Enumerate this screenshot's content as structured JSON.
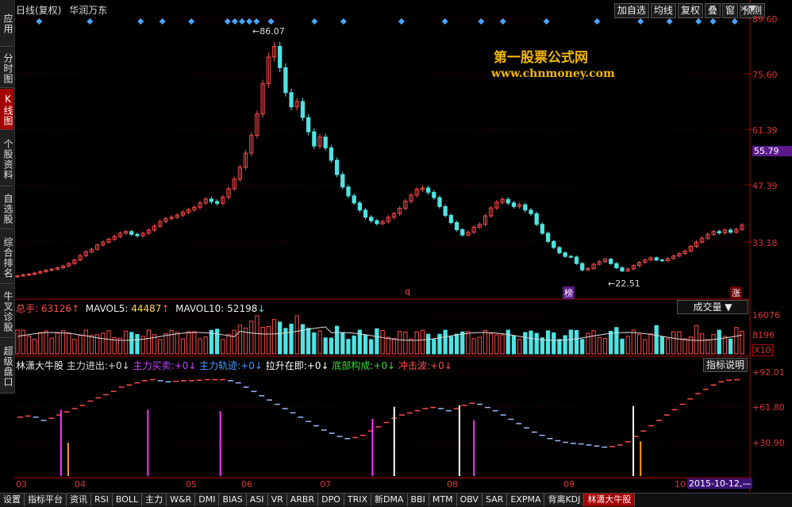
{
  "nav": [
    "应用",
    "分时图",
    "K线图",
    "个股资料",
    "自选股",
    "综合排名",
    "牛叉诊股",
    "超级盘口"
  ],
  "title": {
    "period": "日线(复权)",
    "stock": "华润万东"
  },
  "toolbar": [
    "加自选",
    "均线",
    "复权",
    "叠",
    "窗",
    "预测"
  ],
  "controls": {
    "close": "×",
    "menu": "▼"
  },
  "price_axis": [
    "89.60",
    "75.60",
    "61.39",
    "47.39",
    "33.18"
  ],
  "current_price": "55.79",
  "annotations": {
    "high": "86.07",
    "low": "22.51",
    "q": "q",
    "bang": "榜",
    "zhang": "涨"
  },
  "watermark": {
    "line1": "第一股票公式网",
    "line2": "www.chnmoney.com"
  },
  "volume": {
    "total_label": "总手:",
    "total": "63126",
    "ma5_label": "MAVOL5:",
    "ma5": "44487",
    "ma10_label": "MAVOL10:",
    "ma10": "52198",
    "selector": "成交量 ▼",
    "axis": [
      "16076",
      "8196"
    ],
    "unit": "X10"
  },
  "indicator": {
    "name": "林潇大牛股",
    "fields": [
      {
        "label": "主力进出:",
        "value": "+0",
        "color": "#dddddd"
      },
      {
        "label": "主力买卖:",
        "value": "+0",
        "color": "#cc44ff"
      },
      {
        "label": "主力轨迹:",
        "value": "+0",
        "color": "#4a9cff"
      },
      {
        "label": "拉升在即:",
        "value": "+0",
        "color": "#ffffff"
      },
      {
        "label": "底部构成:",
        "value": "+0",
        "color": "#33dd33"
      },
      {
        "label": "冲击波:",
        "value": "+0",
        "color": "#ff5050"
      }
    ],
    "button": "指标说明",
    "axis": [
      "+92.01",
      "+61.80",
      "+30.90"
    ]
  },
  "date_axis": [
    "03",
    "04",
    "05",
    "06",
    "07",
    "08",
    "09",
    "10"
  ],
  "date_box": "2015-10-12,—",
  "tabs": [
    "设置",
    "指标平台",
    "资讯",
    "RSI",
    "BOLL",
    "主力",
    "W&R",
    "DMI",
    "BIAS",
    "ASI",
    "VR",
    "ARBR",
    "DPO",
    "TRIX",
    "新DMA",
    "BBI",
    "MTM",
    "OBV",
    "SAR",
    "EXPMA",
    "背离KDJ",
    "林潇大牛股"
  ],
  "colors": {
    "up": "#ff4b4b",
    "down": "#4fe3e3",
    "axis": "#b00000",
    "magenta": "#ff33ff",
    "orange": "#ff9d1e"
  },
  "price_series": [
    21.5,
    21.8,
    22.0,
    22.3,
    22.7,
    23.1,
    23.4,
    23.8,
    24.3,
    25.0,
    26.0,
    27.2,
    28.3,
    29.0,
    30.2,
    31.0,
    31.8,
    32.6,
    33.5,
    34.0,
    33.2,
    32.8,
    33.5,
    34.4,
    35.5,
    36.8,
    37.6,
    38.0,
    38.6,
    39.4,
    40.1,
    40.8,
    42.0,
    43.1,
    42.4,
    41.9,
    43.6,
    46.0,
    48.7,
    52.0,
    56.0,
    61.0,
    67.0,
    75.5,
    83.0,
    86.0,
    80.0,
    73.0,
    69.0,
    70.5,
    66.0,
    62.0,
    58.0,
    60.5,
    57.5,
    54.0,
    50.0,
    46.5,
    44.0,
    42.0,
    40.0,
    38.0,
    37.0,
    36.2,
    36.8,
    38.0,
    39.0,
    40.5,
    42.5,
    44.2,
    45.8,
    46.2,
    45.0,
    43.5,
    41.0,
    38.5,
    36.5,
    34.5,
    33.0,
    33.8,
    35.2,
    36.0,
    38.4,
    40.6,
    42.2,
    43.0,
    42.0,
    41.0,
    41.5,
    40.0,
    39.0,
    36.0,
    33.5,
    31.2,
    29.5,
    28.0,
    27.0,
    26.8,
    25.0,
    23.2,
    23.6,
    24.8,
    25.5,
    26.2,
    25.0,
    23.8,
    22.9,
    23.5,
    24.4,
    25.3,
    26.0,
    26.6,
    26.0,
    25.8,
    26.4,
    27.1,
    27.8,
    28.5,
    29.8,
    31.0,
    32.1,
    33.2,
    34.0,
    33.6,
    34.4,
    33.8,
    34.6,
    35.8
  ],
  "main_power": [
    55.0,
    56.0,
    55.0,
    52.0,
    54.0,
    57.0,
    60.0,
    63.0,
    66.0,
    70.0,
    73.0,
    76.0,
    79.0,
    83.0,
    85.0,
    87.0,
    89.0,
    90.0,
    89.0,
    88.0,
    88.5,
    89.0,
    89.0,
    89.5,
    90.0,
    90.0,
    90.0,
    89.0,
    87.0,
    83.0,
    79.0,
    75.0,
    71.0,
    67.0,
    63.0,
    59.0,
    55.0,
    51.0,
    47.0,
    43.0,
    40.0,
    37.0,
    35.0,
    36.0,
    38.0,
    42.0,
    46.0,
    50.0,
    54.0,
    57.0,
    59.0,
    61.0,
    63.0,
    64.0,
    63.0,
    61.0,
    63.0,
    66.0,
    68.0,
    67.0,
    64.0,
    61.0,
    57.0,
    53.0,
    49.0,
    45.0,
    41.0,
    38.0,
    35.0,
    33.0,
    31.5,
    30.5,
    30.0,
    29.0,
    28.0,
    27.0,
    27.5,
    29.0,
    32.0,
    37.0,
    42.0,
    47.0,
    52.0,
    57.0,
    62.0,
    67.0,
    72.0,
    77.0,
    81.0,
    85.0,
    88.0,
    89.5,
    90.0
  ],
  "magenta_bars": [
    {
      "x": 0.06,
      "h": 0.88
    },
    {
      "x": 0.18,
      "h": 0.88
    },
    {
      "x": 0.28,
      "h": 0.86
    },
    {
      "x": 0.49,
      "h": 0.76
    },
    {
      "x": 0.63,
      "h": 0.74
    }
  ],
  "white_bars": [
    {
      "x": 0.52,
      "h": 0.92
    },
    {
      "x": 0.61,
      "h": 0.94
    },
    {
      "x": 0.85,
      "h": 0.93
    }
  ],
  "orange_bars": [
    {
      "x": 0.07,
      "h": 0.44
    },
    {
      "x": 0.86,
      "h": 0.46
    }
  ]
}
